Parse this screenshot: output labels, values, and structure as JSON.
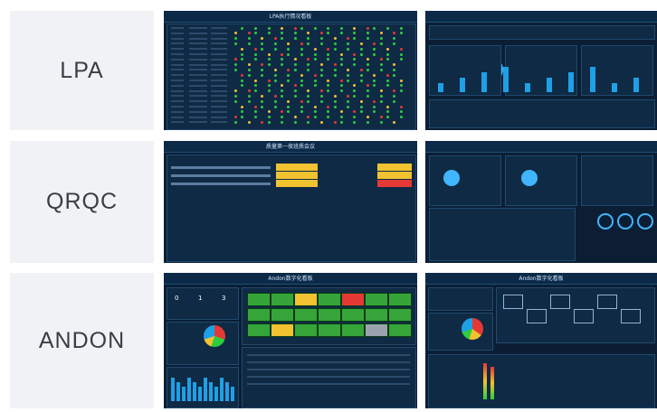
{
  "rows": [
    {
      "label": "LPA"
    },
    {
      "label": "QRQC"
    },
    {
      "label": "ANDON"
    }
  ],
  "thumbs": {
    "lpa_left_title": "LPA执行情况看板",
    "qrqc_left_title": "质量第一夜班质会议",
    "andon_left_title": "Andon数字化看板",
    "andon_right_title": "Andon数字化看板",
    "andon_counters": [
      "0",
      "1",
      "3"
    ]
  },
  "colors": {
    "card_bg": "#f1f2f5",
    "dash_bg": "#0b1e33",
    "accent": "#1ea0e6",
    "ok_green": "#2ecc40",
    "alert_red": "#e53935",
    "warn_yellow": "#f2c230"
  }
}
